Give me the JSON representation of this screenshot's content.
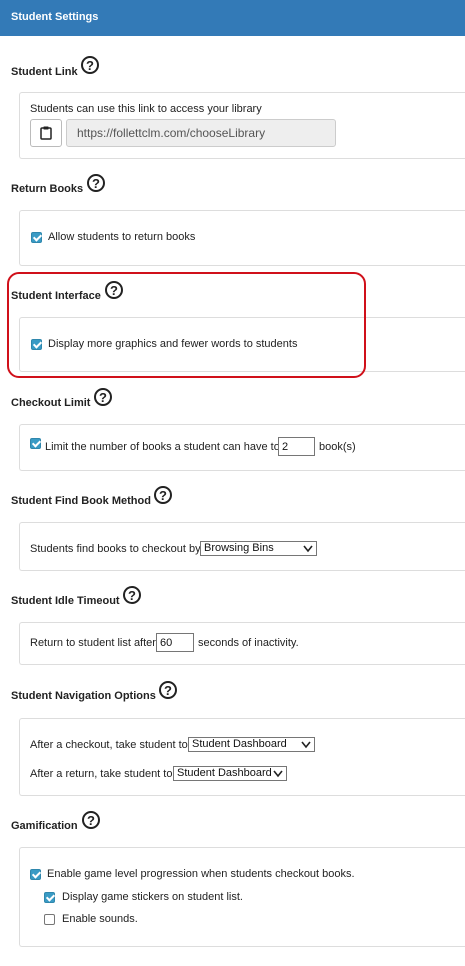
{
  "header": {
    "title": "Student Settings"
  },
  "student_link": {
    "title": "Student Link",
    "description": "Students can use this link to access your library",
    "url": "https://follettclm.com/chooseLibrary",
    "copy_icon": "clipboard-icon"
  },
  "return_books": {
    "title": "Return Books",
    "checkbox_label": "Allow students to return books",
    "checked": true
  },
  "student_interface": {
    "title": "Student Interface",
    "checkbox_label": "Display more graphics and fewer words to students",
    "checked": true,
    "highlight_color": "#d0101a"
  },
  "checkout_limit": {
    "title": "Checkout Limit",
    "label_before": "Limit the number of books a student can have to",
    "value": "2",
    "label_after": "book(s)",
    "checked": true
  },
  "find_book": {
    "title": "Student Find Book Method",
    "label": "Students find books to checkout by",
    "selected": "Browsing Bins"
  },
  "idle_timeout": {
    "title": "Student Idle Timeout",
    "label_before": "Return to student list after",
    "value": "60",
    "label_after": "seconds of inactivity."
  },
  "navigation": {
    "title": "Student Navigation Options",
    "after_checkout_label": "After a checkout, take student to",
    "after_checkout_selected": "Student Dashboard",
    "after_return_label": "After a return, take student to",
    "after_return_selected": "Student Dashboard"
  },
  "gamification": {
    "title": "Gamification",
    "level_label": "Enable game level progression when students checkout books.",
    "level_checked": true,
    "stickers_label": "Display game stickers on student list.",
    "stickers_checked": true,
    "sounds_label": "Enable sounds.",
    "sounds_checked": false
  },
  "colors": {
    "header": "#337ab7",
    "checkbox": "#3a9bc5"
  }
}
